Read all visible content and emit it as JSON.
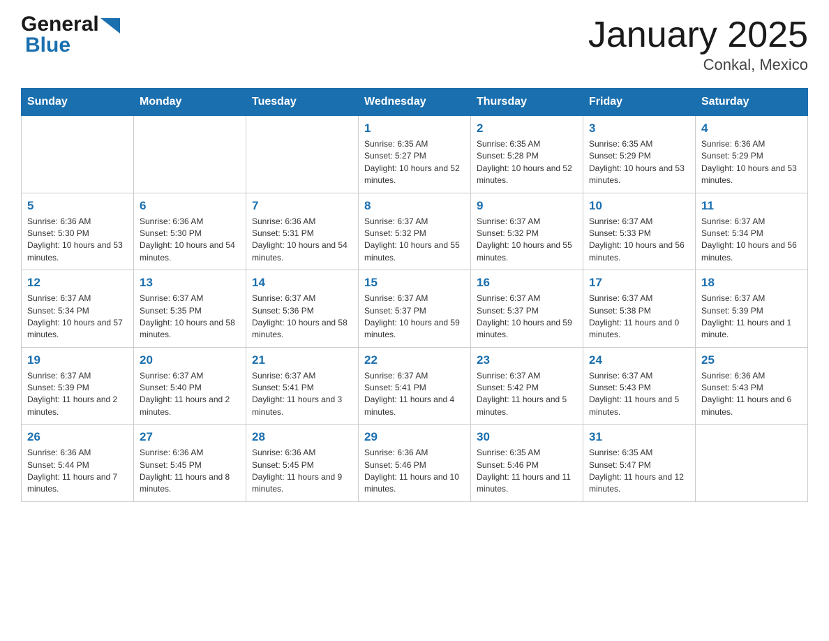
{
  "header": {
    "logo_general": "General",
    "logo_blue": "Blue",
    "title": "January 2025",
    "subtitle": "Conkal, Mexico"
  },
  "calendar": {
    "days_of_week": [
      "Sunday",
      "Monday",
      "Tuesday",
      "Wednesday",
      "Thursday",
      "Friday",
      "Saturday"
    ],
    "weeks": [
      [
        {
          "day": "",
          "info": ""
        },
        {
          "day": "",
          "info": ""
        },
        {
          "day": "",
          "info": ""
        },
        {
          "day": "1",
          "info": "Sunrise: 6:35 AM\nSunset: 5:27 PM\nDaylight: 10 hours and 52 minutes."
        },
        {
          "day": "2",
          "info": "Sunrise: 6:35 AM\nSunset: 5:28 PM\nDaylight: 10 hours and 52 minutes."
        },
        {
          "day": "3",
          "info": "Sunrise: 6:35 AM\nSunset: 5:29 PM\nDaylight: 10 hours and 53 minutes."
        },
        {
          "day": "4",
          "info": "Sunrise: 6:36 AM\nSunset: 5:29 PM\nDaylight: 10 hours and 53 minutes."
        }
      ],
      [
        {
          "day": "5",
          "info": "Sunrise: 6:36 AM\nSunset: 5:30 PM\nDaylight: 10 hours and 53 minutes."
        },
        {
          "day": "6",
          "info": "Sunrise: 6:36 AM\nSunset: 5:30 PM\nDaylight: 10 hours and 54 minutes."
        },
        {
          "day": "7",
          "info": "Sunrise: 6:36 AM\nSunset: 5:31 PM\nDaylight: 10 hours and 54 minutes."
        },
        {
          "day": "8",
          "info": "Sunrise: 6:37 AM\nSunset: 5:32 PM\nDaylight: 10 hours and 55 minutes."
        },
        {
          "day": "9",
          "info": "Sunrise: 6:37 AM\nSunset: 5:32 PM\nDaylight: 10 hours and 55 minutes."
        },
        {
          "day": "10",
          "info": "Sunrise: 6:37 AM\nSunset: 5:33 PM\nDaylight: 10 hours and 56 minutes."
        },
        {
          "day": "11",
          "info": "Sunrise: 6:37 AM\nSunset: 5:34 PM\nDaylight: 10 hours and 56 minutes."
        }
      ],
      [
        {
          "day": "12",
          "info": "Sunrise: 6:37 AM\nSunset: 5:34 PM\nDaylight: 10 hours and 57 minutes."
        },
        {
          "day": "13",
          "info": "Sunrise: 6:37 AM\nSunset: 5:35 PM\nDaylight: 10 hours and 58 minutes."
        },
        {
          "day": "14",
          "info": "Sunrise: 6:37 AM\nSunset: 5:36 PM\nDaylight: 10 hours and 58 minutes."
        },
        {
          "day": "15",
          "info": "Sunrise: 6:37 AM\nSunset: 5:37 PM\nDaylight: 10 hours and 59 minutes."
        },
        {
          "day": "16",
          "info": "Sunrise: 6:37 AM\nSunset: 5:37 PM\nDaylight: 10 hours and 59 minutes."
        },
        {
          "day": "17",
          "info": "Sunrise: 6:37 AM\nSunset: 5:38 PM\nDaylight: 11 hours and 0 minutes."
        },
        {
          "day": "18",
          "info": "Sunrise: 6:37 AM\nSunset: 5:39 PM\nDaylight: 11 hours and 1 minute."
        }
      ],
      [
        {
          "day": "19",
          "info": "Sunrise: 6:37 AM\nSunset: 5:39 PM\nDaylight: 11 hours and 2 minutes."
        },
        {
          "day": "20",
          "info": "Sunrise: 6:37 AM\nSunset: 5:40 PM\nDaylight: 11 hours and 2 minutes."
        },
        {
          "day": "21",
          "info": "Sunrise: 6:37 AM\nSunset: 5:41 PM\nDaylight: 11 hours and 3 minutes."
        },
        {
          "day": "22",
          "info": "Sunrise: 6:37 AM\nSunset: 5:41 PM\nDaylight: 11 hours and 4 minutes."
        },
        {
          "day": "23",
          "info": "Sunrise: 6:37 AM\nSunset: 5:42 PM\nDaylight: 11 hours and 5 minutes."
        },
        {
          "day": "24",
          "info": "Sunrise: 6:37 AM\nSunset: 5:43 PM\nDaylight: 11 hours and 5 minutes."
        },
        {
          "day": "25",
          "info": "Sunrise: 6:36 AM\nSunset: 5:43 PM\nDaylight: 11 hours and 6 minutes."
        }
      ],
      [
        {
          "day": "26",
          "info": "Sunrise: 6:36 AM\nSunset: 5:44 PM\nDaylight: 11 hours and 7 minutes."
        },
        {
          "day": "27",
          "info": "Sunrise: 6:36 AM\nSunset: 5:45 PM\nDaylight: 11 hours and 8 minutes."
        },
        {
          "day": "28",
          "info": "Sunrise: 6:36 AM\nSunset: 5:45 PM\nDaylight: 11 hours and 9 minutes."
        },
        {
          "day": "29",
          "info": "Sunrise: 6:36 AM\nSunset: 5:46 PM\nDaylight: 11 hours and 10 minutes."
        },
        {
          "day": "30",
          "info": "Sunrise: 6:35 AM\nSunset: 5:46 PM\nDaylight: 11 hours and 11 minutes."
        },
        {
          "day": "31",
          "info": "Sunrise: 6:35 AM\nSunset: 5:47 PM\nDaylight: 11 hours and 12 minutes."
        },
        {
          "day": "",
          "info": ""
        }
      ]
    ]
  }
}
